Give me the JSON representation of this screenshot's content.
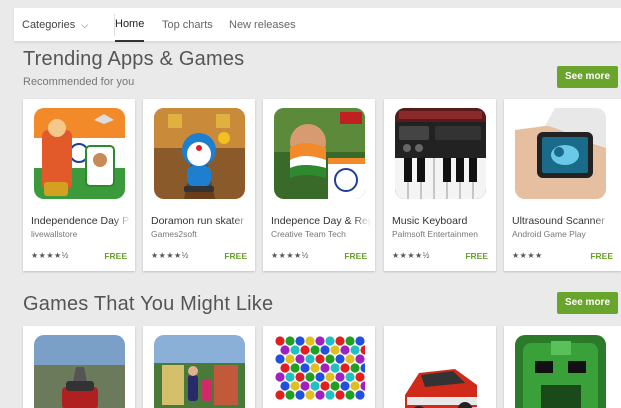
{
  "nav": {
    "categories_label": "Categories",
    "tabs": [
      "Home",
      "Top charts",
      "New releases"
    ]
  },
  "sections": [
    {
      "title": "Trending Apps & Games",
      "subtitle": "Recommended for you",
      "see_more": "See more",
      "apps": [
        {
          "name": "Independence Day Ph",
          "developer": "livewallstore",
          "rating_stars": "★★★★½",
          "price": "FREE",
          "icon": "independence-day-icon"
        },
        {
          "name": "Doramon run skater",
          "developer": "Games2soft",
          "rating_stars": "★★★★½",
          "price": "FREE",
          "icon": "doraemon-icon"
        },
        {
          "name": "Indepence Day & Rep",
          "developer": "Creative Team Tech",
          "rating_stars": "★★★★½",
          "price": "FREE",
          "icon": "india-flag-icon"
        },
        {
          "name": "Music Keyboard",
          "developer": "Palmsoft Entertainmen",
          "rating_stars": "★★★★½",
          "price": "FREE",
          "icon": "piano-keyboard-icon"
        },
        {
          "name": "Ultrasound Scanner",
          "developer": "Android Game Play",
          "rating_stars": "★★★★",
          "price": "FREE",
          "icon": "ultrasound-phone-icon"
        }
      ]
    },
    {
      "title": "Games That You Might Like",
      "see_more": "See more",
      "apps": [
        {
          "icon": "racing-car-icon"
        },
        {
          "icon": "subway-runner-icon"
        },
        {
          "icon": "bubble-shooter-icon"
        },
        {
          "icon": "red-car-icon"
        },
        {
          "icon": "temple-run-icon"
        }
      ]
    }
  ],
  "colors": {
    "accent_green": "#69a42c",
    "price_green": "#6b9f2e",
    "page_bg": "#eaeaea"
  }
}
